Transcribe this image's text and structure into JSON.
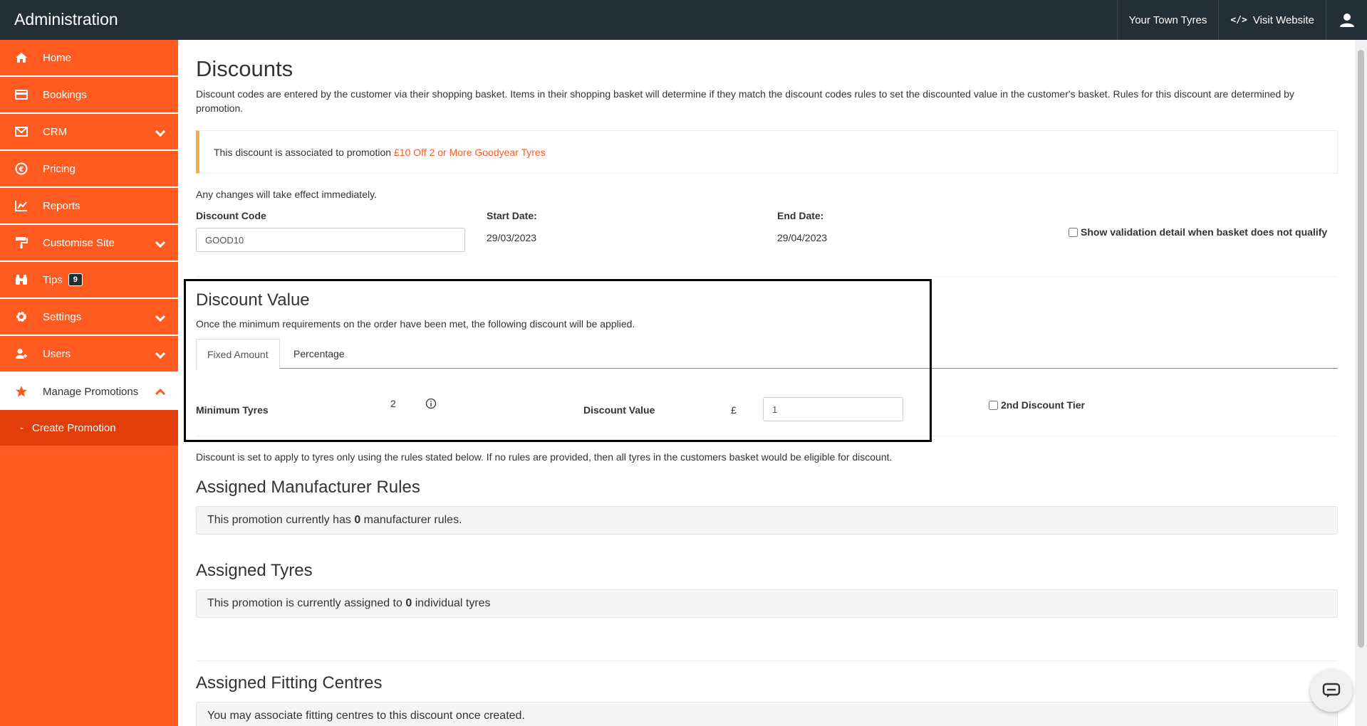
{
  "topbar": {
    "brand": "Administration",
    "account_label": "Your Town Tyres",
    "visit_label": "Visit Website"
  },
  "sidebar": {
    "items": [
      {
        "label": "Home",
        "icon": "home-icon"
      },
      {
        "label": "Bookings",
        "icon": "card-icon"
      },
      {
        "label": "CRM",
        "icon": "envelope-icon"
      },
      {
        "label": "Pricing",
        "icon": "euro-icon"
      },
      {
        "label": "Reports",
        "icon": "chart-icon"
      },
      {
        "label": "Customise Site",
        "icon": "paint-roller-icon"
      },
      {
        "label": "Tips",
        "icon": "binoculars-icon",
        "badge": "9"
      },
      {
        "label": "Settings",
        "icon": "gear-icon"
      },
      {
        "label": "Users",
        "icon": "user-icon"
      },
      {
        "label": "Manage Promotions",
        "icon": "star-icon"
      }
    ],
    "sub_item": "Create Promotion"
  },
  "page": {
    "title": "Discounts",
    "intro": "Discount codes are entered by the customer via their shopping basket. Items in their shopping basket will determine if they match the discount codes rules to set the discounted value in the customer's basket. Rules for this discount are determined by promotion.",
    "alert_text": "This discount is associated to promotion",
    "alert_link": "£10 Off 2 or More Goodyear Tyres",
    "changes_note": "Any changes will take effect immediately.",
    "discount_code_label": "Discount Code",
    "discount_code_value": "GOOD10",
    "start_label": "Start Date:",
    "start_value": "29/03/2023",
    "end_label": "End Date:",
    "end_value": "29/04/2023",
    "validation_checkbox_label": "Show validation detail when basket does not qualify"
  },
  "discount_value": {
    "title": "Discount Value",
    "description": "Once the minimum requirements on the order have been met, the following discount will be applied.",
    "tabs": [
      "Fixed Amount",
      "Percentage"
    ],
    "min_tyres_label": "Minimum Tyres",
    "min_tyres_value": "2",
    "value_label": "Discount Value",
    "currency": "£",
    "value": "1",
    "second_tier_label": "2nd Discount Tier"
  },
  "apply_note": "Discount is set to apply to tyres only using the rules stated below. If no rules are provided, then all tyres in the customers basket would be eligible for discount.",
  "manufacturer_rules": {
    "title": "Assigned Manufacturer Rules",
    "pre": "This promotion currently has",
    "count": "0",
    "post": "manufacturer rules."
  },
  "assigned_tyres": {
    "title": "Assigned Tyres",
    "pre": "This promotion is currently assigned to",
    "count": "0",
    "post": "individual tyres"
  },
  "fitting_centres": {
    "title": "Assigned Fitting Centres",
    "text": "You may associate fitting centres to this discount once created."
  },
  "colors": {
    "accent": "#ff5a1f",
    "topbar": "#232f36",
    "sub_item": "#e13e0b",
    "warning_border": "#f0ad4e"
  }
}
